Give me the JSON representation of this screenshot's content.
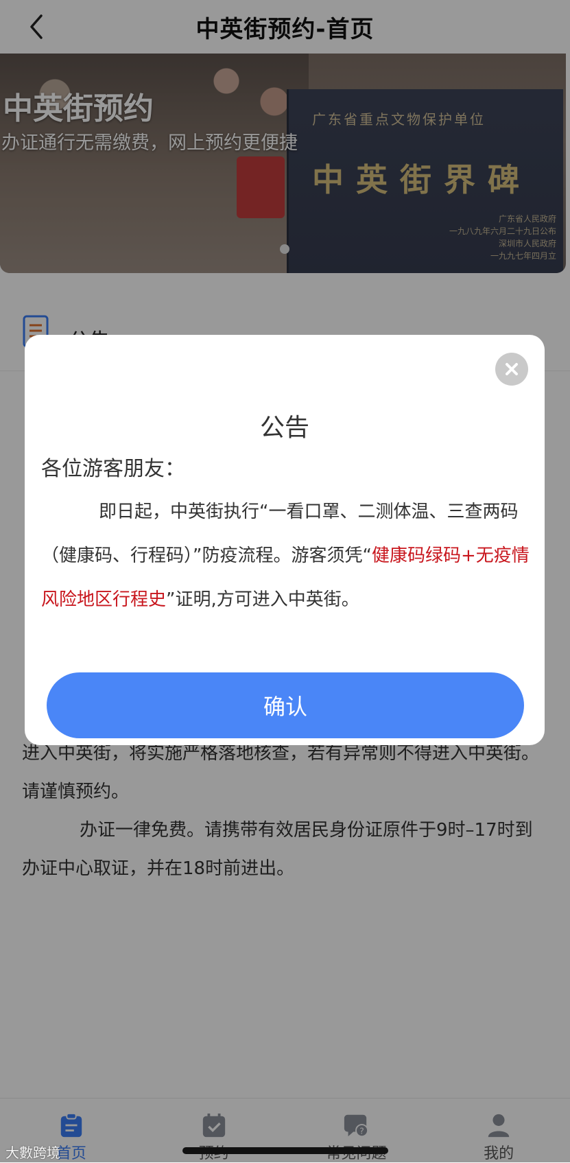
{
  "header": {
    "title": "中英街预约-首页"
  },
  "banner": {
    "title": "中英街预约",
    "subtitle": "办证通行无需缴费，网上预约更便捷",
    "sign_top": "广东省重点文物保护单位",
    "sign_main": "中英街界碑",
    "sign_footer": [
      "广东省人民政府",
      "一九八九年六月二十九日公布",
      "深圳市人民政府",
      "一九九七年四月立"
    ]
  },
  "notice": {
    "title": "公告",
    "paragraph_tail": "进入中英街，将实施严格落地核查，若有异常则不得进入中英街。请谨慎预约。",
    "paragraph_2": "办证一律免费。请携带有效居民身份证原件于9时–17时到办证中心取证，并在18时前进出。"
  },
  "modal": {
    "title": "公告",
    "greeting": "各位游客朋友：",
    "body_part1": "即日起，中英街执行“一看口罩、二测体温、三查两码（健康码、行程码）”防疫流程。游客须凭“",
    "body_red": "健康码绿码+无疫情风险地区行程史",
    "body_part2": "”证明,方可进入中英街。",
    "confirm_label": "确认"
  },
  "tabbar": {
    "items": [
      {
        "label": "首页",
        "icon": "clipboard-icon",
        "active": true
      },
      {
        "label": "预约",
        "icon": "calendar-check-icon",
        "active": false
      },
      {
        "label": "常见问题",
        "icon": "faq-chat-icon",
        "active": false
      },
      {
        "label": "我的",
        "icon": "user-icon",
        "active": false
      }
    ]
  },
  "watermark": "大數跨境",
  "colors": {
    "accent": "#4a86f7",
    "highlight_red": "#c8161d",
    "tab_active": "#3b7df5"
  }
}
